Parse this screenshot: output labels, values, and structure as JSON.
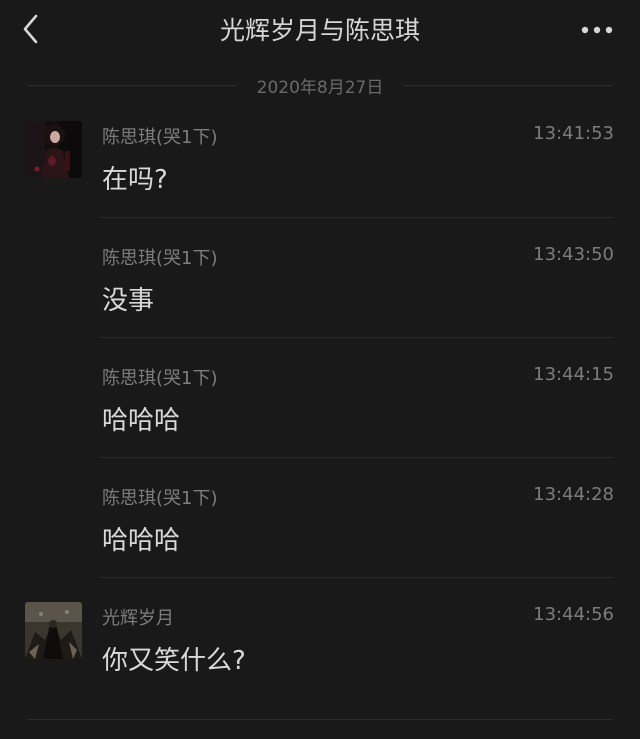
{
  "header": {
    "title": "光辉岁月与陈思琪",
    "back_icon": "chevron-left-icon",
    "more_icon": "more-dots-icon"
  },
  "date_divider": "2020年8月27日",
  "messages": [
    {
      "sender": "陈思琪(哭1下)",
      "time": "13:41:53",
      "text": "在吗?",
      "has_avatar": true
    },
    {
      "sender": "陈思琪(哭1下)",
      "time": "13:43:50",
      "text": "没事",
      "has_avatar": false
    },
    {
      "sender": "陈思琪(哭1下)",
      "time": "13:44:15",
      "text": "哈哈哈",
      "has_avatar": false
    },
    {
      "sender": "陈思琪(哭1下)",
      "time": "13:44:28",
      "text": "哈哈哈",
      "has_avatar": false
    },
    {
      "sender": "光辉岁月",
      "time": "13:44:56",
      "text": "你又笑什么?",
      "has_avatar": true
    }
  ],
  "colors": {
    "background": "#191919",
    "text_primary": "#d9d9d9",
    "text_secondary": "#7c7c7c",
    "divider": "#2b2b2b"
  }
}
